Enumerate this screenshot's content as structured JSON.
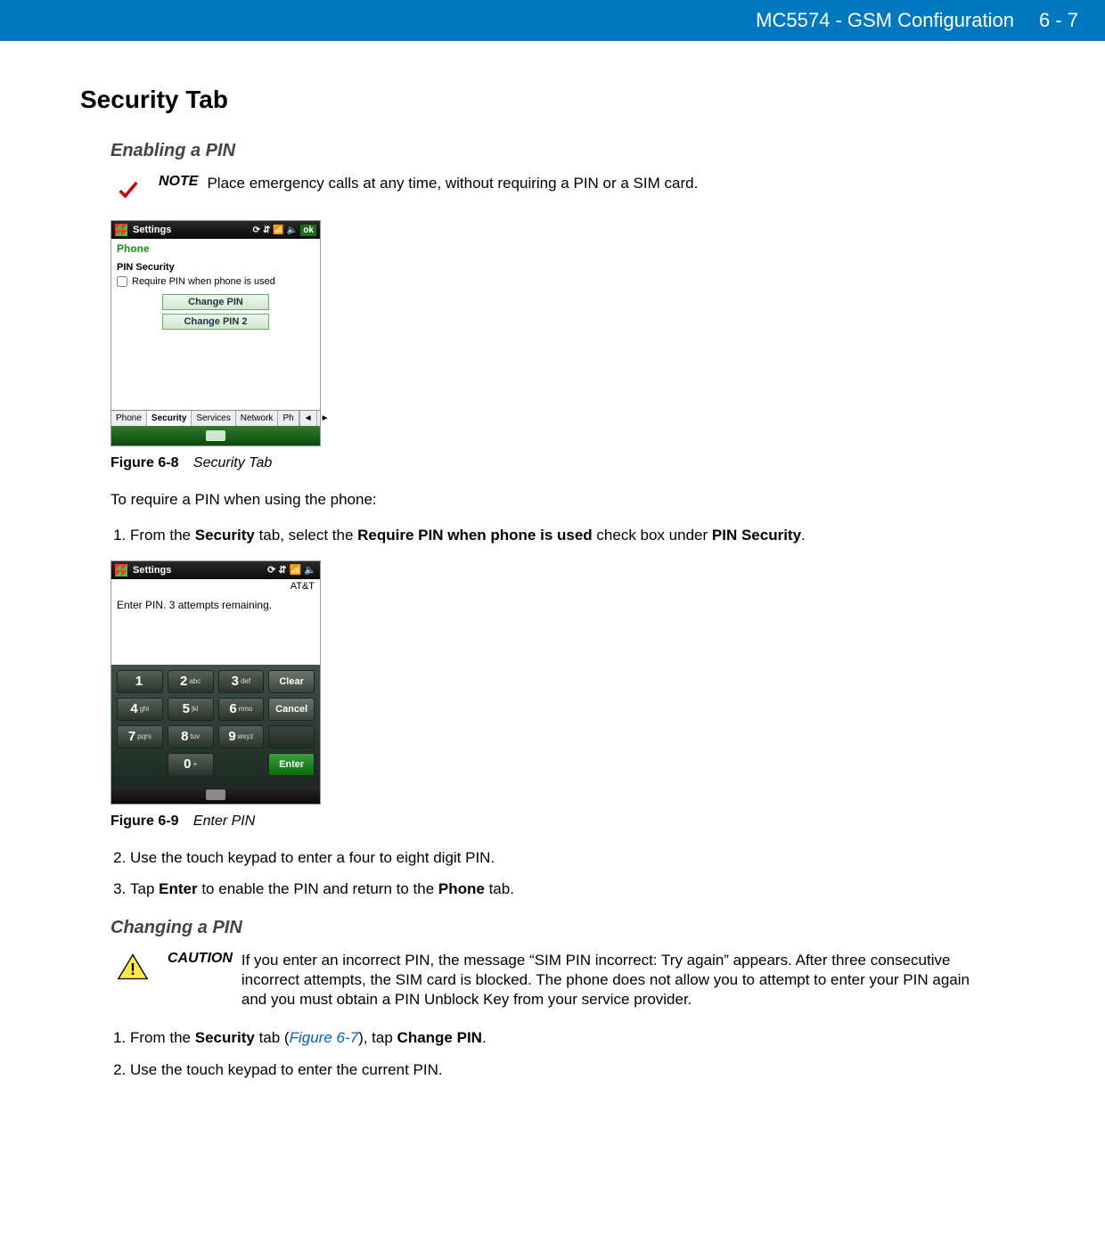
{
  "header": {
    "title": "MC5574 - GSM Configuration",
    "page": "6 - 7"
  },
  "section_title": "Security Tab",
  "enable": {
    "heading": "Enabling a PIN",
    "note_label": "NOTE",
    "note_text": "Place emergency calls at any time, without requiring a PIN or a SIM card.",
    "intro": "To require a PIN when using the phone:",
    "step1_pre": "From the ",
    "step1_b1": "Security",
    "step1_mid1": " tab, select the ",
    "step1_b2": "Require PIN when phone is used",
    "step1_mid2": " check box under ",
    "step1_b3": "PIN Security",
    "step1_end": ".",
    "step2": "Use the touch keypad to enter a four to eight digit PIN.",
    "step3_pre": "Tap ",
    "step3_b1": "Enter",
    "step3_mid": " to enable the PIN and return to the ",
    "step3_b2": "Phone",
    "step3_end": " tab."
  },
  "fig8": {
    "num": "Figure 6-8",
    "title": "Security Tab"
  },
  "fig9": {
    "num": "Figure 6-9",
    "title": "Enter PIN"
  },
  "device1": {
    "title": "Settings",
    "ok": "ok",
    "sub": "Phone",
    "section": "PIN Security",
    "checkbox": "Require PIN when phone is used",
    "btn1": "Change PIN",
    "btn2": "Change PIN 2",
    "tabs": [
      "Phone",
      "Security",
      "Services",
      "Network",
      "Ph"
    ]
  },
  "device2": {
    "title": "Settings",
    "carrier": "AT&T",
    "msg": "Enter PIN. 3 attempts remaining.",
    "keys": {
      "r1": [
        {
          "n": "1",
          "l": ""
        },
        {
          "n": "2",
          "l": "abc"
        },
        {
          "n": "3",
          "l": "def"
        }
      ],
      "r2": [
        {
          "n": "4",
          "l": "ghi"
        },
        {
          "n": "5",
          "l": "jkl"
        },
        {
          "n": "6",
          "l": "mno"
        }
      ],
      "r3": [
        {
          "n": "7",
          "l": "pqrs"
        },
        {
          "n": "8",
          "l": "tuv"
        },
        {
          "n": "9",
          "l": "wxyz"
        }
      ],
      "r4": {
        "n": "0",
        "l": "+"
      }
    },
    "clear": "Clear",
    "cancel": "Cancel",
    "enter": "Enter"
  },
  "change": {
    "heading": "Changing a PIN",
    "caution_label": "CAUTION",
    "caution_text": "If you enter an incorrect PIN, the message “SIM PIN incorrect: Try again” appears. After three consecutive incorrect attempts, the SIM card is blocked. The phone does not allow you to attempt to enter your PIN again and you must obtain a PIN Unblock Key from your service provider.",
    "step1_pre": "From the ",
    "step1_b1": "Security",
    "step1_mid": " tab (",
    "step1_xref": "Figure 6-7",
    "step1_mid2": "), tap ",
    "step1_b2": "Change PIN",
    "step1_end": ".",
    "step2": "Use the touch keypad to enter the current PIN."
  }
}
